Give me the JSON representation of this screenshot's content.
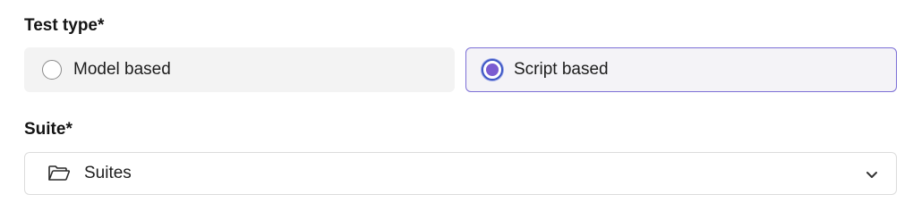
{
  "test_type": {
    "label": "Test type*",
    "options": [
      {
        "label": "Model based",
        "selected": false
      },
      {
        "label": "Script based",
        "selected": true
      }
    ]
  },
  "suite": {
    "label": "Suite*",
    "value": "Suites",
    "icon": "folder-open-icon",
    "dropdown_icon": "chevron-down-icon"
  },
  "colors": {
    "accent": "#7b5cd1",
    "selected_border": "#7c6fd6",
    "option_bg": "#f3f3f3"
  }
}
